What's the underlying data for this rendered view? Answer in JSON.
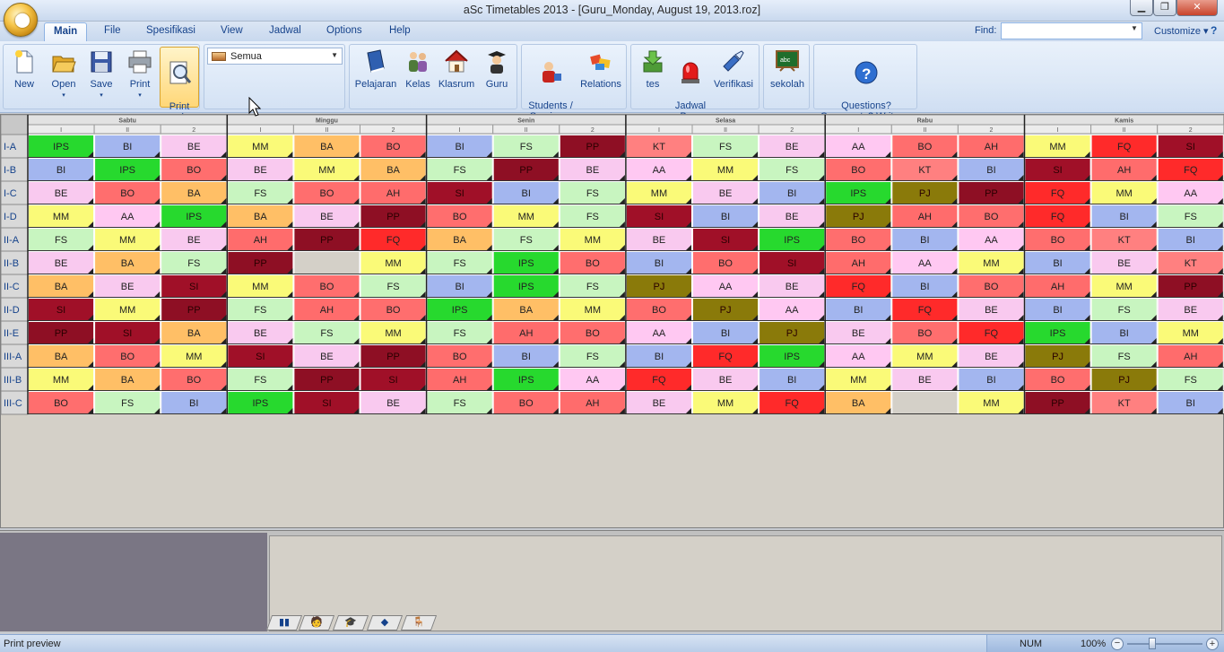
{
  "window": {
    "title": "aSc Timetables 2013  - [Guru_Monday, August 19, 2013.roz]",
    "min_glyph": "▁",
    "max_glyph": "❐",
    "close_glyph": "✕"
  },
  "menu_tabs": [
    "Main",
    "File",
    "Spesifikasi",
    "View",
    "Jadwal",
    "Options",
    "Help"
  ],
  "find": {
    "label": "Find:",
    "value": ""
  },
  "customize": {
    "label": "Customize",
    "arrow": "▾",
    "help": "?"
  },
  "ribbon": {
    "file_buttons": [
      {
        "label": "New",
        "icon": "new-document-icon"
      },
      {
        "label": "Open",
        "icon": "open-folder-icon",
        "arrow": "▾"
      },
      {
        "label": "Save",
        "icon": "save-disk-icon",
        "arrow": "▾"
      },
      {
        "label": "Print",
        "icon": "printer-icon",
        "arrow": "▾"
      },
      {
        "label": "Print\npreview",
        "icon": "print-preview-icon"
      }
    ],
    "filter": {
      "selected": "Semua"
    },
    "data_buttons": [
      {
        "label": "Pelajaran",
        "icon": "book-icon"
      },
      {
        "label": "Kelas",
        "icon": "people-icon"
      },
      {
        "label": "Klasrum",
        "icon": "house-icon"
      },
      {
        "label": "Guru",
        "icon": "teacher-icon"
      }
    ],
    "students_buttons": [
      {
        "label": "Students /\nSeminars",
        "icon": "students-icon"
      },
      {
        "label": "Relations",
        "icon": "relations-icon"
      }
    ],
    "action_buttons": [
      {
        "label": "tes",
        "icon": "download-tray-icon"
      },
      {
        "label": "Jadwal\nBaru",
        "icon": "alarm-light-icon"
      },
      {
        "label": "Verifikasi",
        "icon": "flashlight-icon"
      }
    ],
    "school_button": {
      "label": "sekolah",
      "icon": "blackboard-icon"
    },
    "help_button": {
      "label": "Questions?\nComments? Write us",
      "icon": "question-circle-icon"
    }
  },
  "timetable": {
    "days": [
      "Sabtu",
      "Minggu",
      "Senin",
      "Selasa",
      "Rabu",
      "Kamis"
    ],
    "periods": [
      "I",
      "II",
      "2",
      "I",
      "II",
      "2",
      "I",
      "II",
      "2",
      "I",
      "II",
      "2",
      "I",
      "II",
      "2",
      "I",
      "II",
      "2"
    ],
    "rows": [
      {
        "cls": "I-A",
        "cells": [
          "IPS",
          "BI",
          "BE",
          "MM",
          "BA",
          "BO",
          "BI",
          "FS",
          "PP",
          "KT",
          "FS",
          "BE",
          "AA",
          "BO",
          "AH",
          "MM",
          "FQ",
          "SI"
        ]
      },
      {
        "cls": "I-B",
        "cells": [
          "BI",
          "IPS",
          "BO",
          "BE",
          "MM",
          "BA",
          "FS",
          "PP",
          "BE",
          "AA",
          "MM",
          "FS",
          "BO",
          "KT",
          "BI",
          "SI",
          "AH",
          "FQ"
        ]
      },
      {
        "cls": "I-C",
        "cells": [
          "BE",
          "BO",
          "BA",
          "FS",
          "BO",
          "AH",
          "SI",
          "BI",
          "FS",
          "MM",
          "BE",
          "BI",
          "IPS",
          "PJ",
          "PP",
          "FQ",
          "MM",
          "AA"
        ]
      },
      {
        "cls": "I-D",
        "cells": [
          "MM",
          "AA",
          "IPS",
          "BA",
          "BE",
          "PP",
          "BO",
          "MM",
          "FS",
          "SI",
          "BI",
          "BE",
          "PJ",
          "AH",
          "BO",
          "FQ",
          "BI",
          "FS"
        ]
      },
      {
        "cls": "II-A",
        "cells": [
          "FS",
          "MM",
          "BE",
          "AH",
          "PP",
          "FQ",
          "BA",
          "FS",
          "MM",
          "BE",
          "SI",
          "IPS",
          "BO",
          "BI",
          "AA",
          "BO",
          "KT",
          "BI"
        ]
      },
      {
        "cls": "II-B",
        "cells": [
          "BE",
          "BA",
          "FS",
          "PP",
          "",
          "MM",
          "FS",
          "IPS",
          "BO",
          "BI",
          "BO",
          "SI",
          "AH",
          "AA",
          "MM",
          "BI",
          "BE",
          "KT"
        ]
      },
      {
        "cls": "II-C",
        "cells": [
          "BA",
          "BE",
          "SI",
          "MM",
          "BO",
          "FS",
          "BI",
          "IPS",
          "FS",
          "PJ",
          "AA",
          "BE",
          "FQ",
          "BI",
          "BO",
          "AH",
          "MM",
          "PP"
        ]
      },
      {
        "cls": "II-D",
        "cells": [
          "SI",
          "MM",
          "PP",
          "FS",
          "AH",
          "BO",
          "IPS",
          "BA",
          "MM",
          "BO",
          "PJ",
          "AA",
          "BI",
          "FQ",
          "BE",
          "BI",
          "FS",
          "BE"
        ]
      },
      {
        "cls": "II-E",
        "cells": [
          "PP",
          "SI",
          "BA",
          "BE",
          "FS",
          "MM",
          "FS",
          "AH",
          "BO",
          "AA",
          "BI",
          "PJ",
          "BE",
          "BO",
          "FQ",
          "IPS",
          "BI",
          "MM"
        ]
      },
      {
        "cls": "III-A",
        "cells": [
          "BA",
          "BO",
          "MM",
          "SI",
          "BE",
          "PP",
          "BO",
          "BI",
          "FS",
          "BI",
          "FQ",
          "IPS",
          "AA",
          "MM",
          "BE",
          "PJ",
          "FS",
          "AH"
        ]
      },
      {
        "cls": "III-B",
        "cells": [
          "MM",
          "BA",
          "BO",
          "FS",
          "PP",
          "SI",
          "AH",
          "IPS",
          "AA",
          "FQ",
          "BE",
          "BI",
          "MM",
          "BE",
          "BI",
          "BO",
          "PJ",
          "FS"
        ]
      },
      {
        "cls": "III-C",
        "cells": [
          "BO",
          "FS",
          "BI",
          "IPS",
          "SI",
          "BE",
          "FS",
          "BO",
          "AH",
          "BE",
          "MM",
          "FQ",
          "BA",
          "",
          "MM",
          "PP",
          "KT",
          "BI"
        ]
      }
    ],
    "subject_colors": {
      "IPS": "#27d92e",
      "BI": "#a3b6ef",
      "BE": "#f9c9ef",
      "MM": "#fafa78",
      "BA": "#ffbf66",
      "BO": "#ff6e6e",
      "FS": "#c8f5c0",
      "PP": "#8e0f24",
      "KT": "#ff8080",
      "AA": "#ffc8f2",
      "AH": "#ff6c6c",
      "FQ": "#ff2a2a",
      "SI": "#a01028",
      "PJ": "#8a7a0a"
    }
  },
  "lower_tabs": [
    "▮▮",
    "🧑",
    "🎓",
    "◆",
    "🪑"
  ],
  "status": {
    "text": "Print preview",
    "num": "NUM",
    "zoom": "100%",
    "zoom_minus": "−",
    "zoom_plus": "+",
    "zoom_level": 0.3
  }
}
